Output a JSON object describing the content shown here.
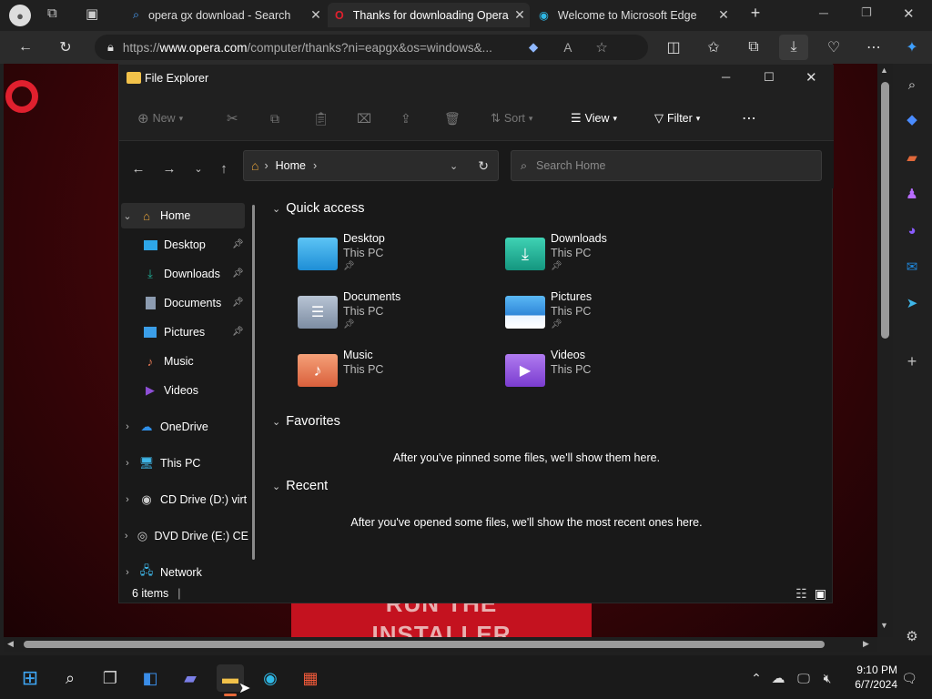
{
  "browser": {
    "tabs": [
      {
        "title": "opera gx download - Search",
        "active": false,
        "icon": "search-icon"
      },
      {
        "title": "Thanks for downloading Opera",
        "active": true,
        "icon": "opera-icon"
      },
      {
        "title": "Welcome to Microsoft Edge",
        "active": false,
        "icon": "edge-icon"
      }
    ],
    "url_prefix": "https://",
    "url_host": "www.opera.com",
    "url_path": "/computer/thanks?ni=eapgx&os=windows&..."
  },
  "page": {
    "hero_line1": "RUN THE",
    "hero_line2": "INSTALLER"
  },
  "explorer": {
    "title": "File Explorer",
    "commands": {
      "new": "New",
      "sort": "Sort",
      "view": "View",
      "filter": "Filter"
    },
    "breadcrumb": "Home",
    "search_placeholder": "Search Home",
    "sidebar": [
      {
        "label": "Home",
        "icon": "home-icon",
        "pinned": false
      },
      {
        "label": "Desktop",
        "icon": "desktop-icon",
        "pinned": true
      },
      {
        "label": "Downloads",
        "icon": "download-icon",
        "pinned": true
      },
      {
        "label": "Documents",
        "icon": "documents-icon",
        "pinned": true
      },
      {
        "label": "Pictures",
        "icon": "pictures-icon",
        "pinned": true
      },
      {
        "label": "Music",
        "icon": "music-icon",
        "pinned": false
      },
      {
        "label": "Videos",
        "icon": "videos-icon",
        "pinned": false
      },
      {
        "label": "OneDrive",
        "icon": "cloud-icon",
        "pinned": false
      },
      {
        "label": "This PC",
        "icon": "pc-icon",
        "pinned": false
      },
      {
        "label": "CD Drive (D:) virt",
        "icon": "cd-drive-icon",
        "pinned": false
      },
      {
        "label": "DVD Drive (E:) CE",
        "icon": "dvd-drive-icon",
        "pinned": false
      },
      {
        "label": "Network",
        "icon": "network-icon",
        "pinned": false
      }
    ],
    "quick_access_title": "Quick access",
    "quick_access": [
      {
        "name": "Desktop",
        "location": "This PC",
        "pinned": true,
        "color": "#2ea6e8"
      },
      {
        "name": "Downloads",
        "location": "This PC",
        "pinned": true,
        "color": "#1fb39a"
      },
      {
        "name": "Documents",
        "location": "This PC",
        "pinned": true,
        "color": "#8c9bb0"
      },
      {
        "name": "Pictures",
        "location": "This PC",
        "pinned": true,
        "color": "#3b9ee8"
      },
      {
        "name": "Music",
        "location": "This PC",
        "pinned": false,
        "color": "#e87a55"
      },
      {
        "name": "Videos",
        "location": "This PC",
        "pinned": false,
        "color": "#8e4fd6"
      }
    ],
    "favorites_title": "Favorites",
    "favorites_empty": "After you've pinned some files, we'll show them here.",
    "recent_title": "Recent",
    "recent_empty": "After you've opened some files, we'll show the most recent ones here.",
    "status": "6 items"
  },
  "taskbar": {
    "time": "9:10 PM",
    "date": "6/7/2024"
  },
  "colors": {
    "accent": "#1f6fd1",
    "opera_red": "#c4121f"
  }
}
